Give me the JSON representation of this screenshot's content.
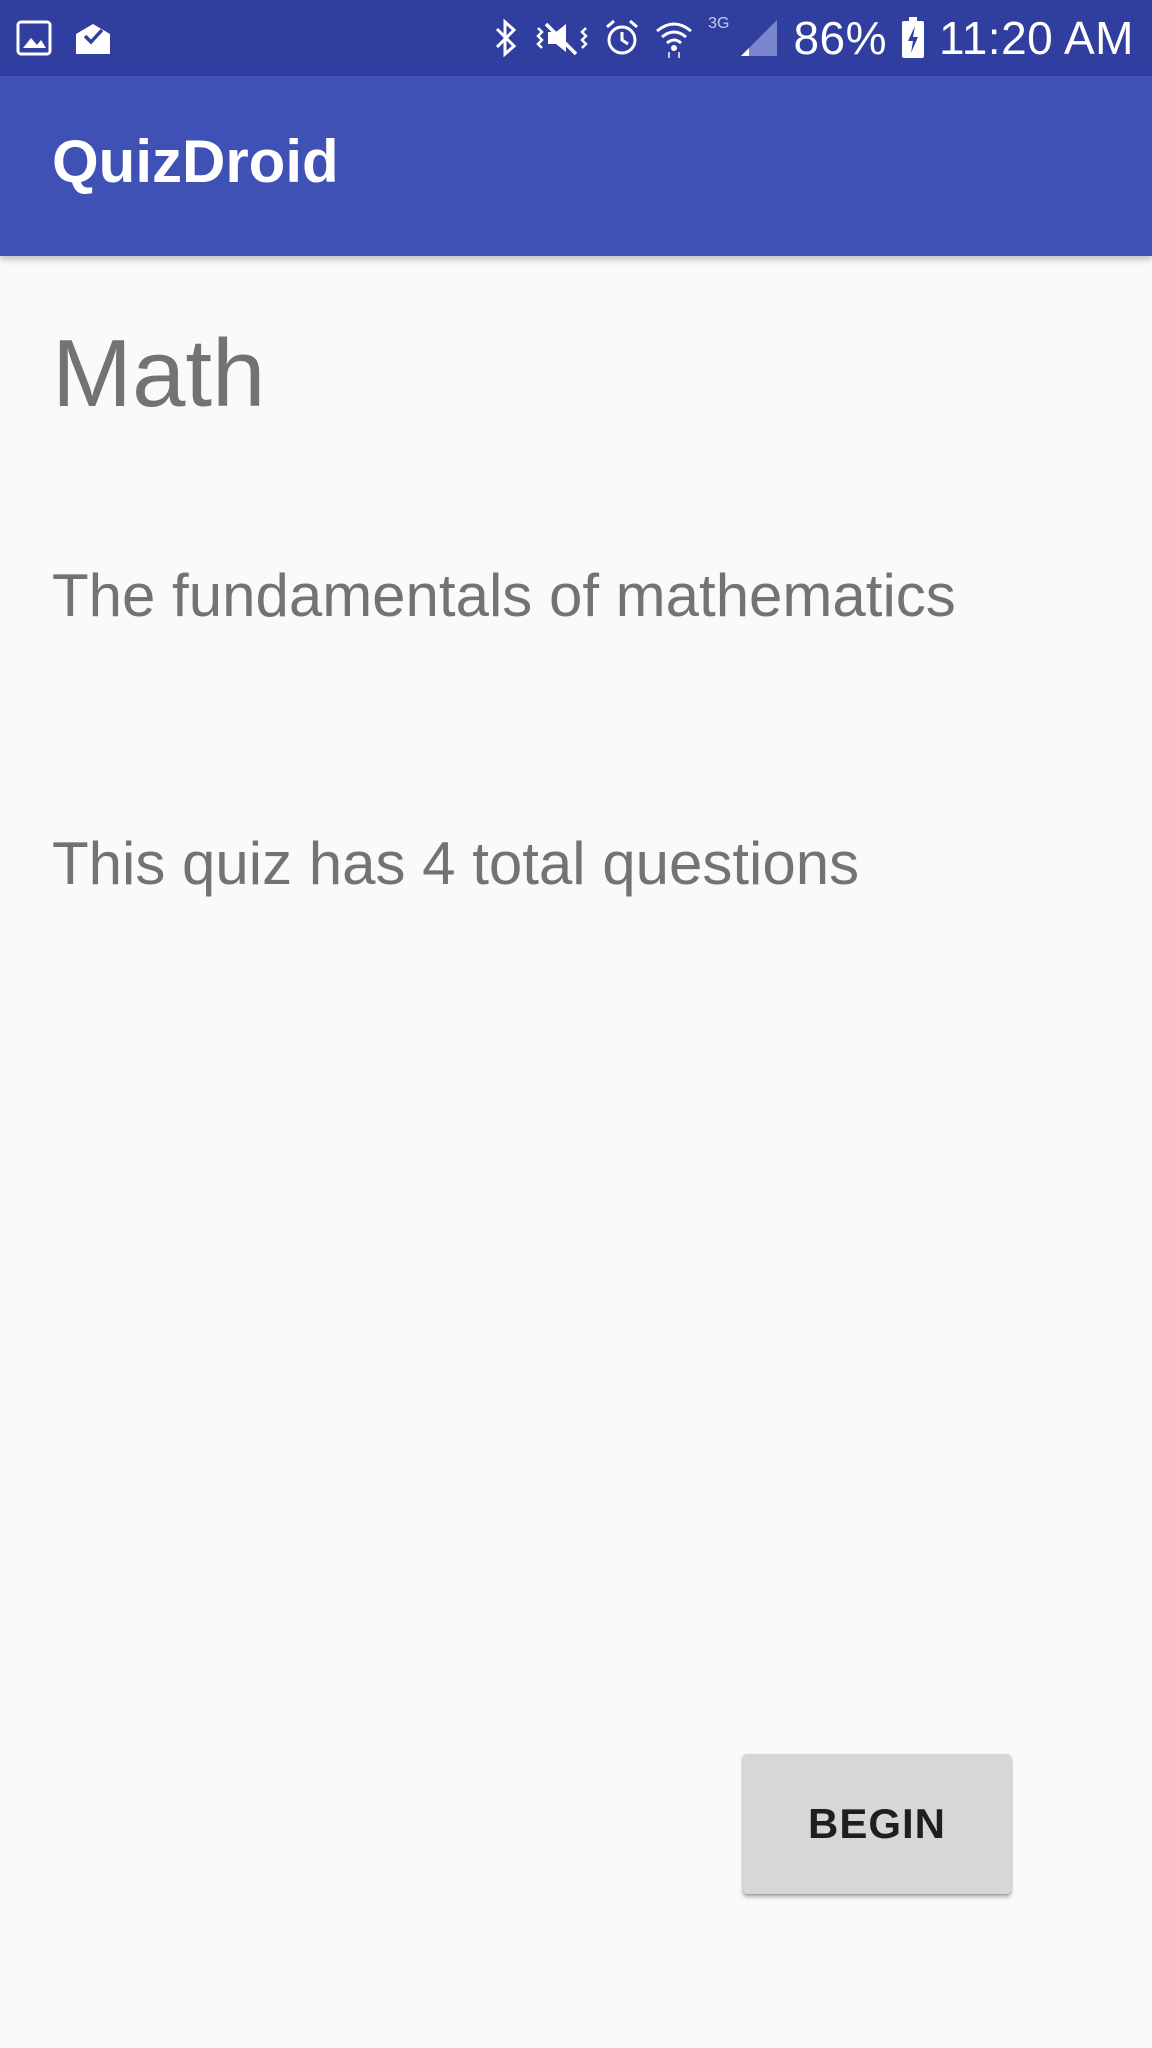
{
  "status_bar": {
    "icons_left": [
      "gallery-icon",
      "mail-check-icon"
    ],
    "icons_right": [
      "bluetooth-icon",
      "vibrate-icon",
      "alarm-icon",
      "wifi-icon",
      "signal-icon",
      "battery-charging-icon"
    ],
    "network_type": "3G",
    "battery_percent": "86%",
    "time": "11:20 AM",
    "background_color": "#303f9f"
  },
  "app_bar": {
    "title": "QuizDroid",
    "background_color": "#3f51b5"
  },
  "quiz": {
    "title": "Math",
    "description": "The fundamentals of mathematics",
    "question_count_text": "This quiz has 4 total questions"
  },
  "actions": {
    "begin_label": "BEGIN"
  }
}
